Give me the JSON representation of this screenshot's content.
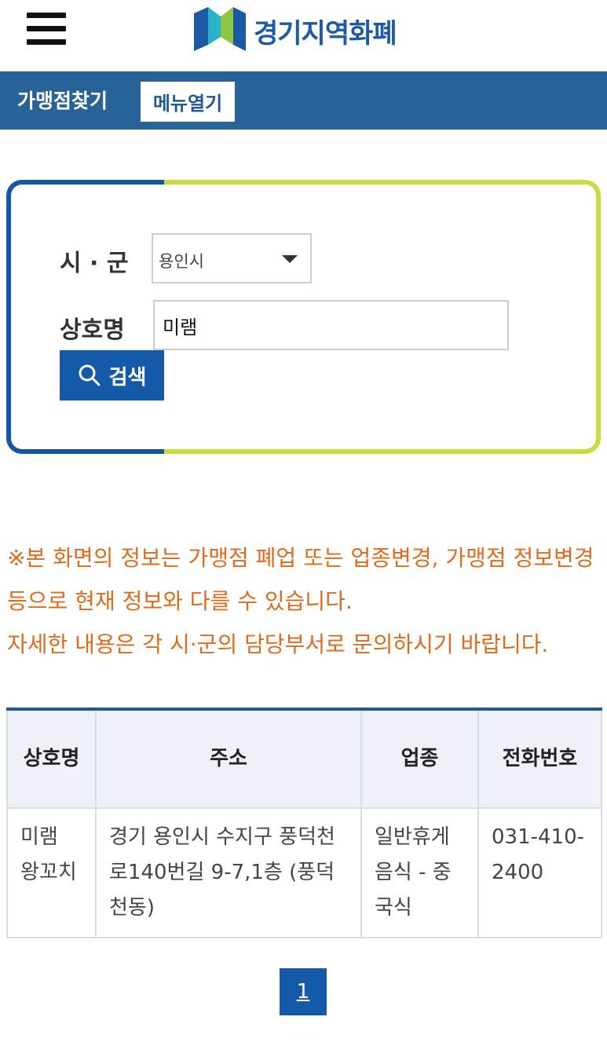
{
  "header": {
    "logo_text": "경기지역화폐",
    "menu_icon": "hamburger-menu-icon"
  },
  "nav": {
    "title": "가맹점찾기",
    "menu_button": "메뉴열기"
  },
  "search": {
    "city_label": "시 · 군",
    "city_value": "용인시",
    "name_label": "상호명",
    "name_value": "미램",
    "search_button": "검색"
  },
  "notice": {
    "line1": "※본 화면의 정보는 가맹점 폐업 또는 업종변경, 가맹점 정보변경 등으로 현재 정보와 다를 수 있습니다.",
    "line2": "자세한 내용은 각 시·군의 담당부서로 문의하시기 바랍니다."
  },
  "table": {
    "headers": [
      "상호명",
      "주소",
      "업종",
      "전화번호"
    ],
    "rows": [
      [
        "미램 왕꼬치",
        "경기 용인시 수지구 풍덕천로140번길 9-7,1층 (풍덕천동)",
        "일반휴게음식 - 중국식",
        "031-410-2400"
      ]
    ]
  },
  "pagination": {
    "current": "1"
  },
  "colors": {
    "nav_blue": "#276398",
    "button_blue": "#155aa8",
    "accent_green": "#c9dc3d",
    "notice_orange": "#e06a1b"
  }
}
